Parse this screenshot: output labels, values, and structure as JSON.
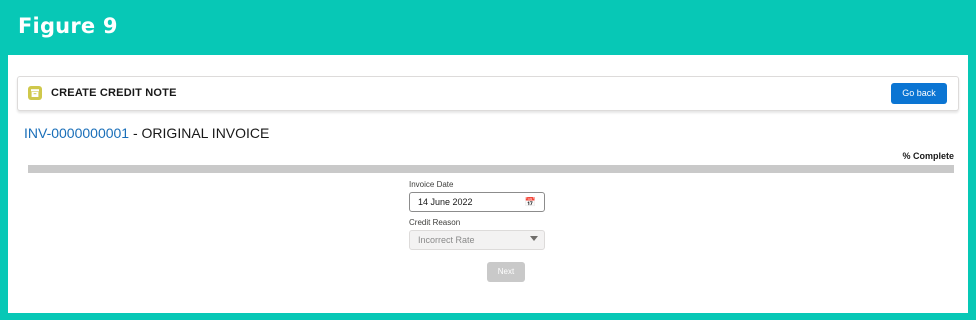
{
  "figure": {
    "title": "Figure 9"
  },
  "header": {
    "title": "CREATE CREDIT NOTE",
    "go_back_label": "Go back",
    "icon": "archive-icon"
  },
  "invoice": {
    "number": "INV-0000000001",
    "suffix": " - ORIGINAL INVOICE"
  },
  "progress": {
    "label": "% Complete",
    "value": 0
  },
  "form": {
    "invoice_date_label": "Invoice Date",
    "invoice_date_value": "14 June 2022",
    "credit_reason_label": "Credit Reason",
    "credit_reason_value": "Incorrect Rate",
    "next_label": "Next"
  },
  "colors": {
    "frame": "#07c8b6",
    "brand_button": "#0b75d3",
    "link": "#1a6fb9",
    "icon_tile": "#cfc84b"
  }
}
